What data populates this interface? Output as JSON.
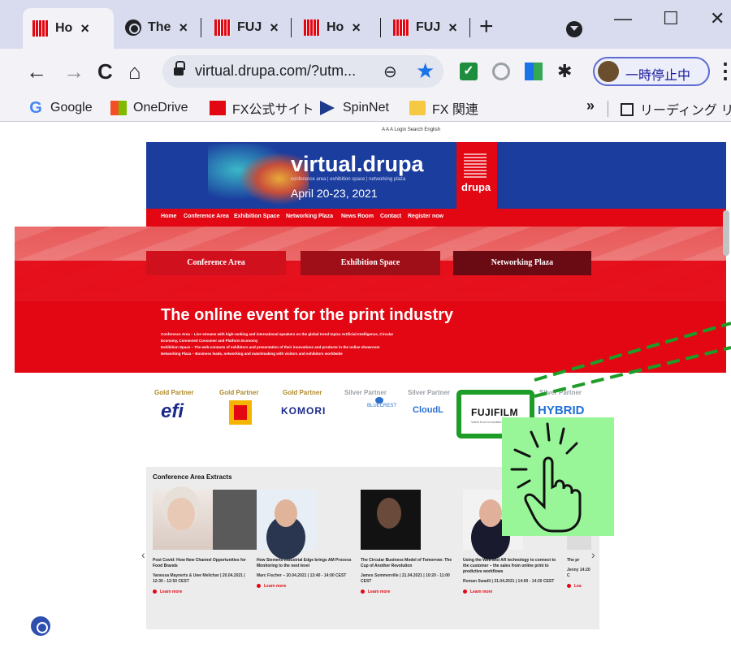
{
  "tabs": [
    {
      "title": "Ho",
      "close": "×",
      "icon": "drupa-favicon"
    },
    {
      "title": "The",
      "close": "×",
      "icon": "globe-icon"
    },
    {
      "title": "FUJ",
      "close": "×",
      "icon": "drupa-favicon"
    },
    {
      "title": "Ho",
      "close": "×",
      "icon": "drupa-favicon"
    },
    {
      "title": "FUJ",
      "close": "×",
      "icon": "drupa-favicon"
    }
  ],
  "new_tab": "+",
  "window": {
    "minimize": "—",
    "maximize": "☐",
    "close": "✕"
  },
  "nav": {
    "back": "←",
    "forward": "→",
    "reload": "C",
    "home": "⌂"
  },
  "omnibox": {
    "url": "virtual.drupa.com/?utm...",
    "zoom": "⊖",
    "star": "★"
  },
  "profile": {
    "label": "一時停止中"
  },
  "menu": "⋮",
  "bookmarks": [
    {
      "label": "Google",
      "icon": "google-icon"
    },
    {
      "label": "OneDrive",
      "icon": "onedrive-icon"
    },
    {
      "label": "FX公式サイト",
      "icon": "fx-icon"
    },
    {
      "label": "SpinNet",
      "icon": "spinnet-icon"
    },
    {
      "label": "FX 関連",
      "icon": "folder-icon"
    }
  ],
  "bookmarks_more": "»",
  "reading_list": "リーディング リスト",
  "page": {
    "utility": "A A A   Login   Search   English",
    "hero": {
      "title": "virtual.drupa",
      "subtitle": "conference area | exhibition space | networking plaza",
      "date": "April 20-23, 2021",
      "badge": "drupa"
    },
    "menu_items": [
      "Home",
      "Conference Area",
      "Exhibition Space",
      "Networking Plaza",
      "News Room",
      "Contact",
      "Register now"
    ],
    "cta": [
      "Conference Area",
      "Exhibition Space",
      "Networking Plaza"
    ],
    "tagline": "The online event for the print industry",
    "tagline_lines": [
      "Conference Area – Live streams with high-ranking and international speakers on the global trend topics Artificial Intelligence, Circular",
      "Economy, Connected Consumer and Platform Economy",
      "Exhibition Space – The web-contacts of exhibitors and presentation of their innovations and products in the online showroom",
      "Networking Plaza – Business leads, networking and matchmaking with visitors and exhibitors worldwide"
    ],
    "partners": [
      {
        "label": "Gold Partner",
        "logo": "efi"
      },
      {
        "label": "Gold Partner",
        "logo": "Kodak"
      },
      {
        "label": "Gold Partner",
        "logo": "KOMORI"
      },
      {
        "label": "Silver Partner",
        "logo": "BLUECREST"
      },
      {
        "label": "Silver Partner",
        "logo": "CloudL"
      },
      {
        "label": "",
        "logo": "FUJIFILM",
        "sub": "Value from Innovation"
      },
      {
        "label": "Silver Partner",
        "logo": "HYBRID"
      }
    ],
    "conference": {
      "title": "Conference Area Extracts",
      "cards": [
        {
          "title": "Post Covid: How New Channel Opportunities for Food Brands",
          "meta": "Vanessa Maynerts & Uwe Melichar | 20.04.2021 | 12:30 - 12:50 CEST",
          "more": "Learn more"
        },
        {
          "title": "How Siemens Industrial Edge brings AM Process Monitoring to the next level",
          "meta": "Marc Fischer – 20.04.2021 | 13:40 - 14:00 CEST",
          "more": "Learn more"
        },
        {
          "title": "The Circular Business Model of Tomorrow: The Cup of Another Revolution",
          "meta": "James Sommerville | 21.04.2021 | 10:20 - 11:00 CEST",
          "more": "Learn more"
        },
        {
          "title": "Using the Web and AR technology to connect to the customer – the sales from online print to predictive workflows",
          "meta": "Roman Swadli | 21.04.2021 | 14:00 - 14:20 CEST",
          "more": "Learn more"
        },
        {
          "title": "The pr",
          "meta": "Jenny 14:20 C",
          "more": "Lea"
        }
      ],
      "prev": "‹",
      "next": "›"
    }
  },
  "annotation": {
    "highlight_color": "#1e9c28",
    "tap_bg": "#98f598",
    "target": "FUJIFILM"
  }
}
